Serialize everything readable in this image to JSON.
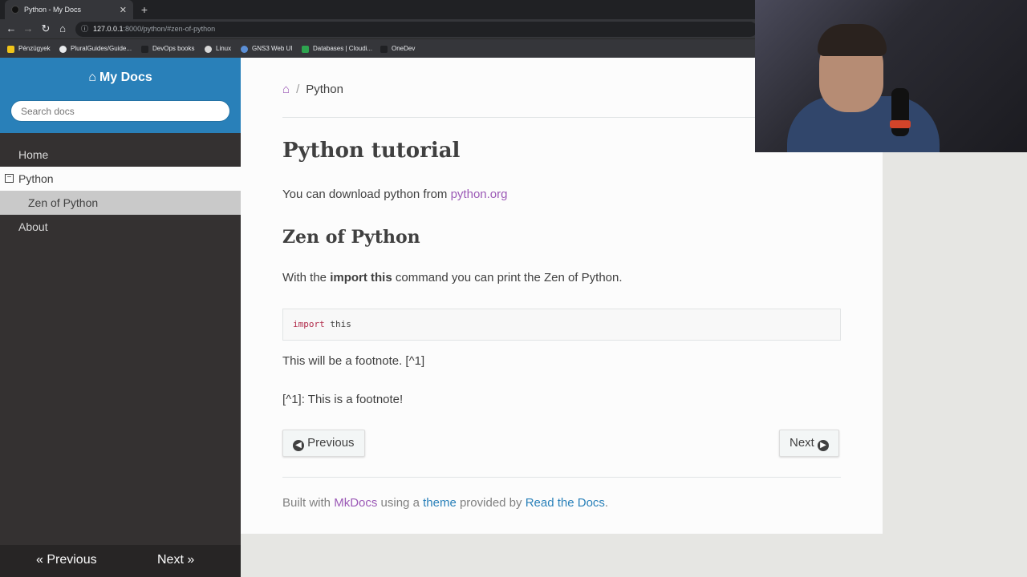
{
  "browser": {
    "tab_title": "Python - My Docs",
    "tab_close": "✕",
    "new_tab": "+",
    "url_host": "127.0.0.1",
    "url_rest": ":8000/python/#zen-of-python",
    "bookmarks": [
      "Pénzügyek",
      "PluralGuides/Guide...",
      "DevOps books",
      "Linux",
      "GNS3 Web UI",
      "Databases | Cloudi...",
      "OneDev"
    ]
  },
  "sidebar": {
    "brand": "My Docs",
    "search_placeholder": "Search docs",
    "items": [
      {
        "label": "Home"
      },
      {
        "label": "Python"
      },
      {
        "label": "Zen of Python"
      },
      {
        "label": "About"
      }
    ],
    "prev": "« Previous",
    "next": "Next »"
  },
  "content": {
    "breadcrumb_current": "Python",
    "title": "Python tutorial",
    "p1_text": "You can download python from ",
    "p1_link": "python.org",
    "h2": "Zen of Python",
    "p2_before": "With the ",
    "p2_bold": "import this",
    "p2_after": " command you can print the Zen of Python.",
    "code_kw": "import",
    "code_rest": " this",
    "p3": "This will be a footnote. [^1]",
    "p4": "[^1]: This is a footnote!",
    "btn_prev": "Previous",
    "btn_next": "Next",
    "footer_built": "Built with ",
    "footer_mkdocs": "MkDocs",
    "footer_using": " using a ",
    "footer_theme": "theme",
    "footer_provided": " provided by ",
    "footer_rtd": "Read the Docs",
    "footer_end": "."
  },
  "colors": {
    "sidebar_header": "#2980b9",
    "sidebar_bg": "#343131",
    "link": "#9b59b6",
    "link_blue": "#2980b9"
  }
}
